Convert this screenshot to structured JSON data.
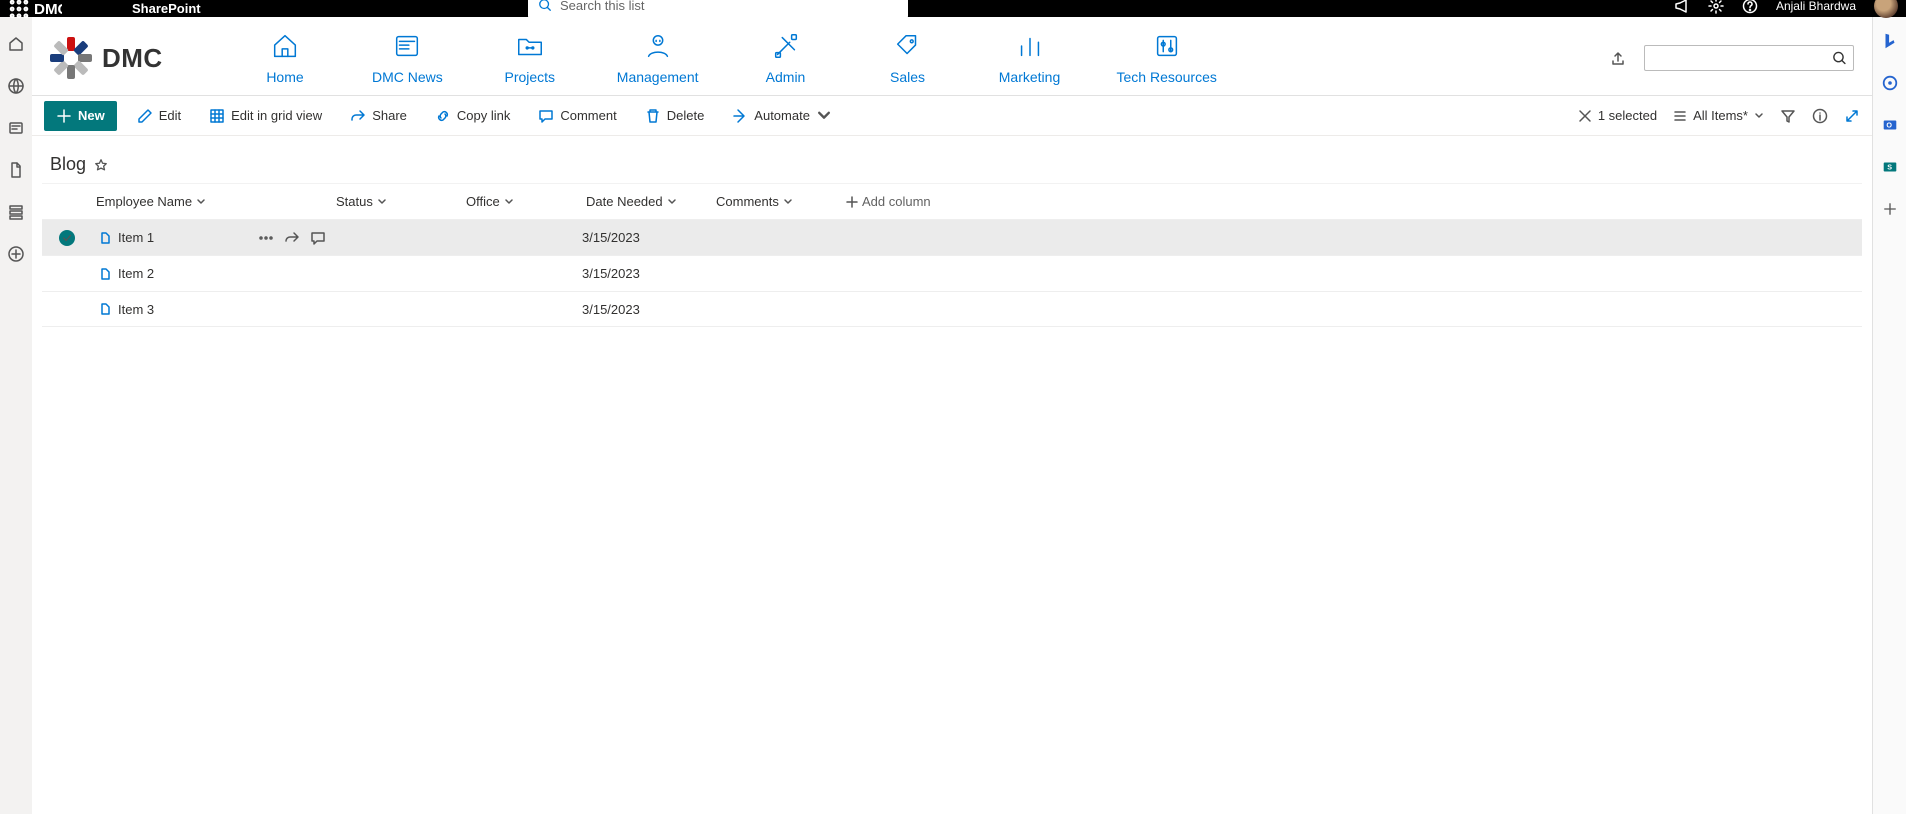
{
  "suitebar": {
    "app_label": "SharePoint",
    "search_placeholder": "Search this list",
    "user_name": "Anjali Bhardwa"
  },
  "site": {
    "logo_text": "DMC",
    "topnav": [
      {
        "label": "Home",
        "icon": "home"
      },
      {
        "label": "DMC News",
        "icon": "news"
      },
      {
        "label": "Projects",
        "icon": "folder"
      },
      {
        "label": "Management",
        "icon": "person"
      },
      {
        "label": "Admin",
        "icon": "tools"
      },
      {
        "label": "Sales",
        "icon": "tag"
      },
      {
        "label": "Marketing",
        "icon": "chart"
      },
      {
        "label": "Tech Resources",
        "icon": "sliders"
      }
    ]
  },
  "commands": {
    "new": "New",
    "edit": "Edit",
    "edit_grid": "Edit in grid view",
    "share": "Share",
    "copy_link": "Copy link",
    "comment": "Comment",
    "delete": "Delete",
    "automate": "Automate",
    "selected": "1 selected",
    "view": "All Items*"
  },
  "list": {
    "title": "Blog",
    "columns": {
      "employee": "Employee Name",
      "status": "Status",
      "office": "Office",
      "date_needed": "Date Needed",
      "comments": "Comments",
      "add": "Add column"
    },
    "rows": [
      {
        "name": "Item 1",
        "date": "3/15/2023",
        "selected": true
      },
      {
        "name": "Item 2",
        "date": "3/15/2023",
        "selected": false
      },
      {
        "name": "Item 3",
        "date": "3/15/2023",
        "selected": false
      }
    ]
  }
}
